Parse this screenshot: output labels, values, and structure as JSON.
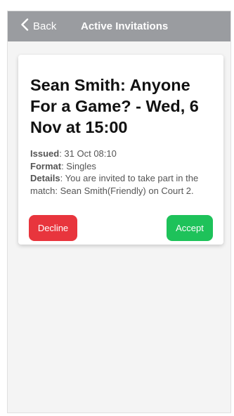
{
  "header": {
    "back_label": "Back",
    "title": "Active Invitations"
  },
  "invitation": {
    "title": "Sean Smith: Anyone For a Game? - Wed, 6 Nov at 15:00",
    "issued_label": "Issued",
    "issued_value": ": 31 Oct 08:10",
    "format_label": "Format",
    "format_value": ": Singles",
    "details_label": "Details",
    "details_value": ": You are invited to take part in the match: Sean Smith(Friendly) on Court 2.",
    "decline_label": "Decline",
    "accept_label": "Accept"
  },
  "colors": {
    "navbar": "#9a9ca0",
    "decline": "#e8353d",
    "accept": "#1ec25a"
  },
  "icons": {
    "back": "chevron-left-icon"
  }
}
